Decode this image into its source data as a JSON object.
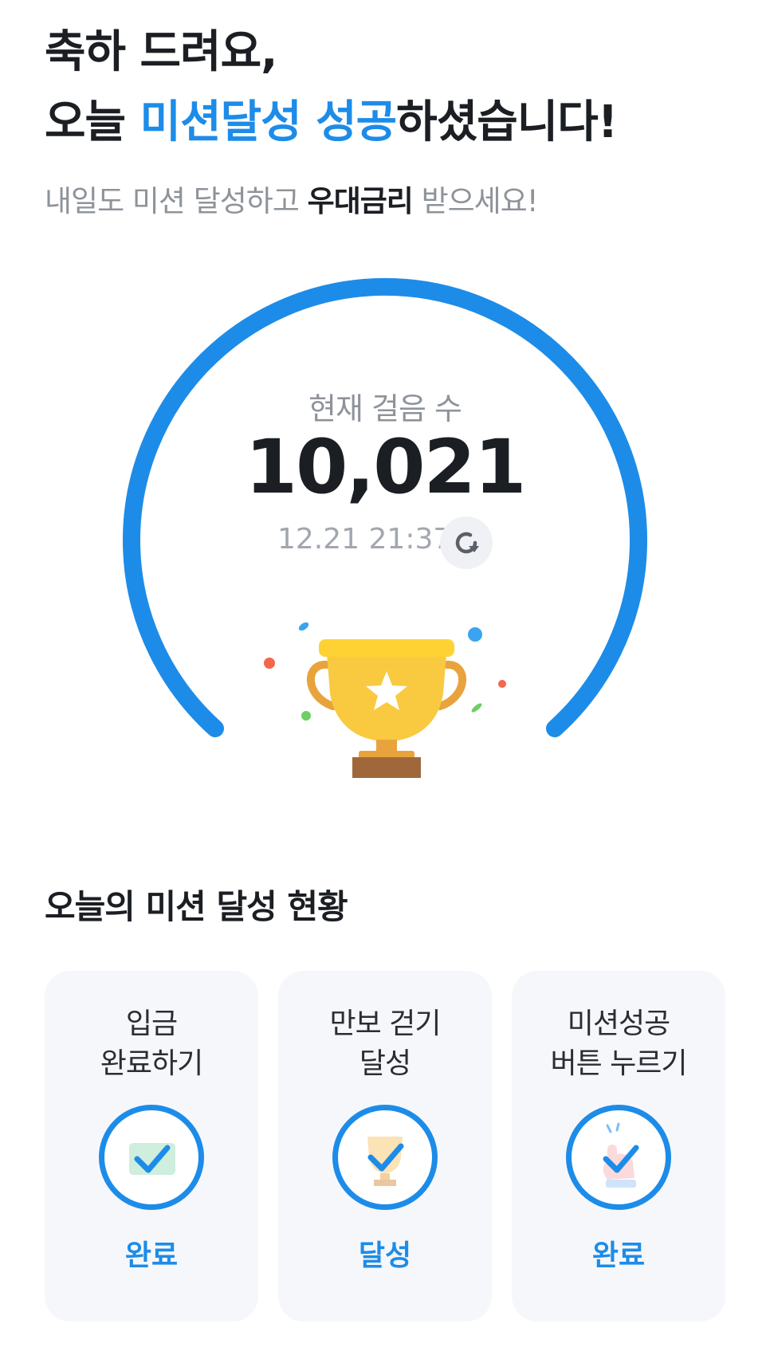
{
  "header": {
    "line1": "축하 드려요,",
    "line2_prefix": "오늘 ",
    "line2_accent": "미션달성 성공",
    "line2_suffix": "하셨습니다!"
  },
  "subheader": {
    "prefix": "내일도 미션 달성하고 ",
    "strong": "우대금리",
    "suffix": " 받으세요!"
  },
  "steps": {
    "label": "현재 걸음 수",
    "value": "10,021",
    "updated_at": "12.21 21:37",
    "refresh_icon": "refresh-icon",
    "trophy_icon": "trophy-icon"
  },
  "missions": {
    "title": "오늘의 미션 달성 현황",
    "items": [
      {
        "title_line1": "입금",
        "title_line2": "완료하기",
        "status": "완료",
        "icon": "deposit-check-icon"
      },
      {
        "title_line1": "만보 걷기",
        "title_line2": "달성",
        "status": "달성",
        "icon": "trophy-check-icon"
      },
      {
        "title_line1": "미션성공",
        "title_line2": "버튼 누르기",
        "status": "완료",
        "icon": "tap-check-icon"
      }
    ]
  },
  "colors": {
    "accent": "#1d8ce8",
    "text": "#1b1e23",
    "muted": "#8e939a",
    "card_bg": "#f6f7fb",
    "trophy": "#f9c940"
  }
}
